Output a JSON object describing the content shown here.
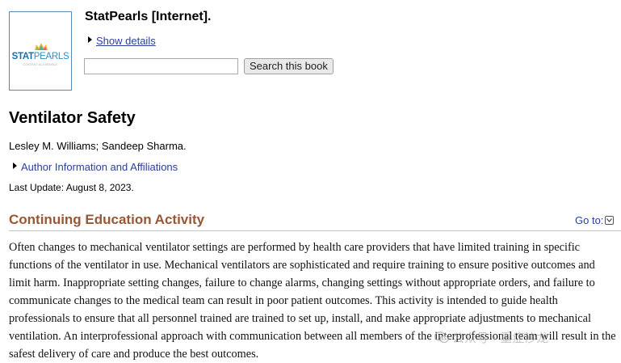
{
  "cover": {
    "logo_bold": "STAT",
    "logo_light": "PEARLS",
    "tagline": "CONTENT ACCESSIBLE"
  },
  "book": {
    "title": "StatPearls [Internet].",
    "show_details": "Show details"
  },
  "search": {
    "placeholder": "",
    "value": "",
    "button_label": "Search this book"
  },
  "article": {
    "title": "Ventilator Safety",
    "authors": "Lesley M. Williams; Sandeep Sharma.",
    "affiliations_link": "Author Information and Affiliations",
    "last_update": "Last Update: August 8, 2023."
  },
  "section": {
    "heading": "Continuing Education Activity",
    "goto_label": "Go to:",
    "body": "Often changes to mechanical ventilator settings are performed by health care providers that have limited training in specific functions of the ventilator in use. Mechanical ventilators are sophisticated and require training to ensure positive outcomes and limit harm. Inappropriate setting changes, failure to change alarms, changing settings without appropriate orders, and failure to communicate changes to the medical team can result in poor patient outcomes. This activity is intended to guide health professionals to ensure that all personnel trained are trained to set up, install, and make appropriate adjustments to mechanical ventilation. An interprofessional approach with communication between all members of the interprofessional team will result in the safest delivery of care and produce the best outcomes."
  },
  "watermark": {
    "text": "公众号 · 重症沙龙",
    "icon": "wechat-icon"
  },
  "colors": {
    "link": "#2a3f9c",
    "section_heading": "#985735",
    "logo_blue": "#1a6fa8"
  }
}
